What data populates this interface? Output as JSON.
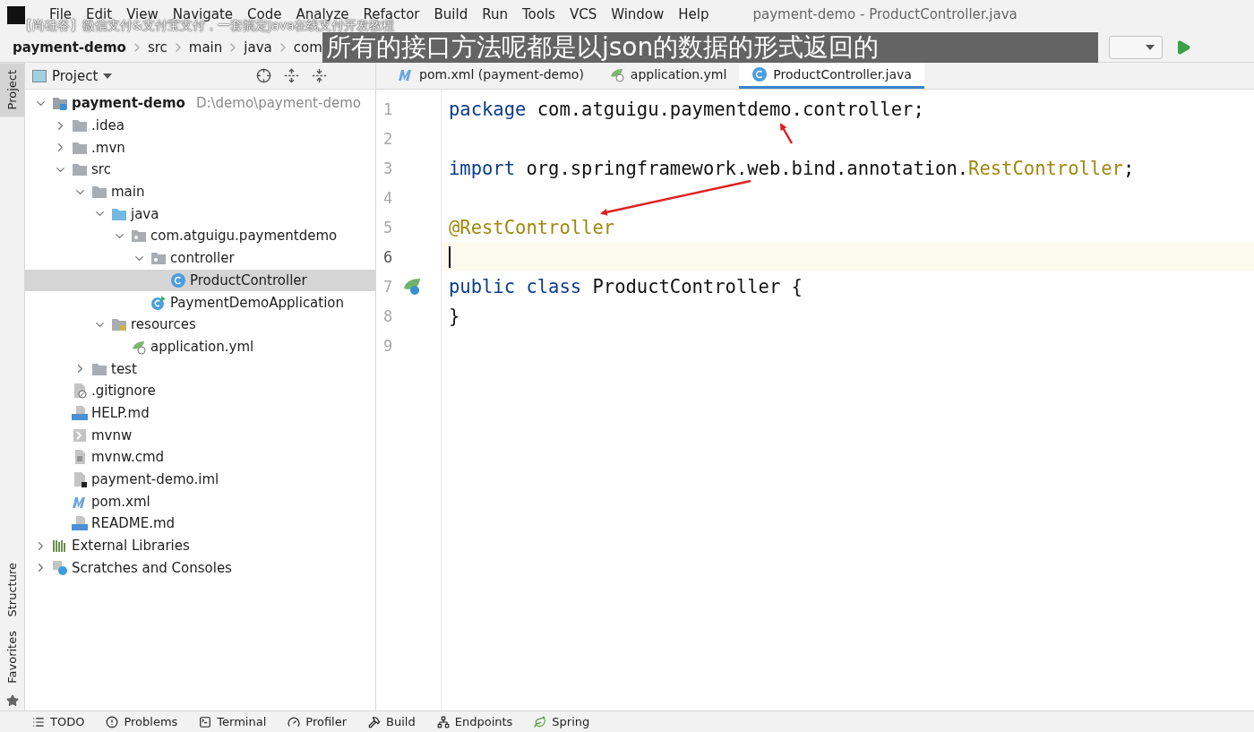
{
  "menu_bar": {
    "items": [
      "File",
      "Edit",
      "View",
      "Navigate",
      "Code",
      "Analyze",
      "Refactor",
      "Build",
      "Run",
      "Tools",
      "VCS",
      "Window",
      "Help"
    ],
    "window_title": "payment-demo - ProductController.java"
  },
  "video_title": "【尚硅谷】微信支付&支付宝支付，一套搞定Java在线支付开发教程",
  "subtitle": "所有的接口方法呢都是以json的数据的形式返回的",
  "breadcrumbs": [
    {
      "label": "payment-demo",
      "bold": true
    },
    {
      "label": "src",
      "bold": false
    },
    {
      "label": "main",
      "bold": false
    },
    {
      "label": "java",
      "bold": false
    },
    {
      "label": "com",
      "bold": false
    }
  ],
  "side_tabs": [
    {
      "label": "Project",
      "selected": true
    },
    {
      "label": "Structure",
      "selected": false
    },
    {
      "label": "Favorites",
      "selected": false
    }
  ],
  "project_panel": {
    "title": "Project",
    "tree": [
      {
        "label": "payment-demo",
        "hint": "D:\\demo\\payment-demo",
        "kind": "module",
        "expanded": true,
        "selected": false,
        "children": [
          {
            "label": ".idea",
            "kind": "folder",
            "expanded": false,
            "selected": false
          },
          {
            "label": ".mvn",
            "kind": "folder",
            "expanded": false,
            "selected": false
          },
          {
            "label": "src",
            "kind": "folder",
            "expanded": true,
            "selected": false,
            "children": [
              {
                "label": "main",
                "kind": "folder",
                "expanded": true,
                "selected": false,
                "children": [
                  {
                    "label": "java",
                    "kind": "source",
                    "expanded": true,
                    "selected": false,
                    "children": [
                      {
                        "label": "com.atguigu.paymentdemo",
                        "kind": "package",
                        "expanded": true,
                        "selected": false,
                        "children": [
                          {
                            "label": "controller",
                            "kind": "package",
                            "expanded": true,
                            "selected": false,
                            "children": [
                              {
                                "label": "ProductController",
                                "kind": "class",
                                "selected": true
                              }
                            ]
                          },
                          {
                            "label": "PaymentDemoApplication",
                            "kind": "springclass",
                            "selected": false
                          }
                        ]
                      }
                    ]
                  },
                  {
                    "label": "resources",
                    "kind": "resources",
                    "expanded": true,
                    "selected": false,
                    "children": [
                      {
                        "label": "application.yml",
                        "kind": "yml",
                        "selected": false
                      }
                    ]
                  }
                ]
              },
              {
                "label": "test",
                "kind": "folder",
                "expanded": false,
                "selected": false
              }
            ]
          },
          {
            "label": ".gitignore",
            "kind": "gitignore",
            "selected": false
          },
          {
            "label": "HELP.md",
            "kind": "markdown",
            "selected": false
          },
          {
            "label": "mvnw",
            "kind": "shell",
            "selected": false
          },
          {
            "label": "mvnw.cmd",
            "kind": "text",
            "selected": false
          },
          {
            "label": "payment-demo.iml",
            "kind": "iml",
            "selected": false
          },
          {
            "label": "pom.xml",
            "kind": "maven",
            "selected": false
          },
          {
            "label": "README.md",
            "kind": "markdown",
            "selected": false
          }
        ]
      },
      {
        "label": "External Libraries",
        "kind": "libraries",
        "expanded": false,
        "selected": false
      },
      {
        "label": "Scratches and Consoles",
        "kind": "scratches",
        "expanded": false,
        "selected": false
      }
    ]
  },
  "editor": {
    "tabs": [
      {
        "label": "pom.xml (payment-demo)",
        "kind": "maven",
        "selected": false
      },
      {
        "label": "application.yml",
        "kind": "yml",
        "selected": false
      },
      {
        "label": "ProductController.java",
        "kind": "class",
        "selected": true
      }
    ],
    "lines": [
      {
        "number": "1",
        "current": false,
        "gutter_mark": false,
        "tokens": [
          {
            "text": "package",
            "kind": "keyword"
          },
          {
            "text": " com.atguigu.paymentdemo.controller;",
            "kind": "plain"
          }
        ]
      },
      {
        "number": "2",
        "current": false,
        "gutter_mark": false
      },
      {
        "number": "3",
        "current": false,
        "gutter_mark": false,
        "tokens": [
          {
            "text": "import",
            "kind": "keyword"
          },
          {
            "text": " org.springframework.web.bind.annotation.",
            "kind": "plain"
          },
          {
            "text": "RestController",
            "kind": "annotation"
          },
          {
            "text": ";",
            "kind": "plain"
          }
        ]
      },
      {
        "number": "4",
        "current": false,
        "gutter_mark": false
      },
      {
        "number": "5",
        "current": false,
        "gutter_mark": false,
        "tokens": [
          {
            "text": "@RestController",
            "kind": "annotation"
          }
        ]
      },
      {
        "number": "6",
        "current": true,
        "gutter_mark": false
      },
      {
        "number": "7",
        "current": false,
        "gutter_mark": true,
        "tokens": [
          {
            "text": "public class",
            "kind": "keyword"
          },
          {
            "text": " ProductController {",
            "kind": "plain"
          }
        ]
      },
      {
        "number": "8",
        "current": false,
        "gutter_mark": false,
        "tokens": [
          {
            "text": "}",
            "kind": "plain"
          }
        ]
      },
      {
        "number": "9",
        "current": false,
        "gutter_mark": false
      }
    ]
  },
  "tool_windows": [
    {
      "label": "TODO",
      "kind": "todo"
    },
    {
      "label": "Problems",
      "kind": "problems"
    },
    {
      "label": "Terminal",
      "kind": "terminal"
    },
    {
      "label": "Profiler",
      "kind": "profiler"
    },
    {
      "label": "Build",
      "kind": "build"
    },
    {
      "label": "Endpoints",
      "kind": "endpoints"
    },
    {
      "label": "Spring",
      "kind": "spring"
    }
  ]
}
